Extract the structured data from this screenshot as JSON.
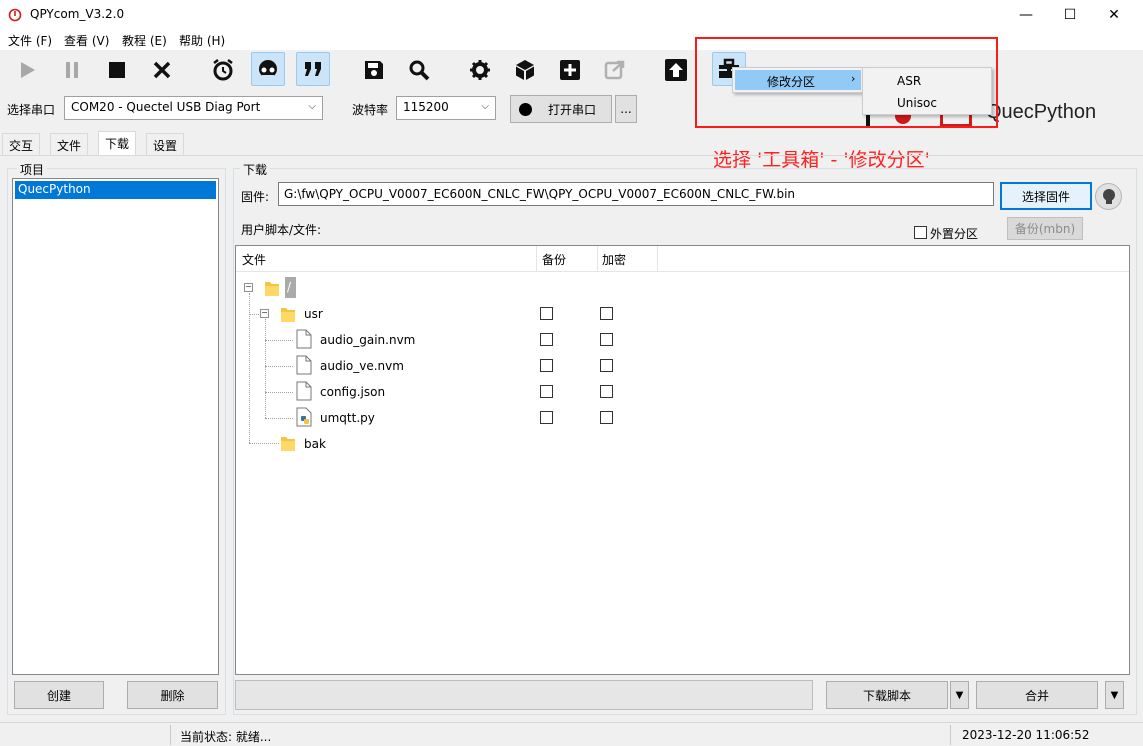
{
  "window": {
    "title": "QPYcom_V3.2.0",
    "min_glyph": "—",
    "max_glyph": "☐",
    "close_glyph": "✕"
  },
  "menubar": [
    "文件 (F)",
    "查看 (V)",
    "教程 (E)",
    "帮助 (H)"
  ],
  "toolbar": {
    "icons": [
      "play-icon",
      "pause-icon",
      "stop-icon",
      "close-x-icon",
      "alarm-clock-icon",
      "recorder-icon",
      "quote-icon",
      "save-icon",
      "search-icon",
      "gear-icon",
      "cube-icon",
      "plus-icon",
      "share-icon",
      "upload-icon",
      "toolbox-icon"
    ]
  },
  "port": {
    "label": "选择串口",
    "value": "COM20 - Quectel USB Diag Port",
    "baud_label": "波特率",
    "baud_value": "115200",
    "open_label": "打开串口",
    "more_label": "..."
  },
  "tabs": [
    "交互",
    "文件",
    "下载",
    "设置"
  ],
  "selected_tab": "下载",
  "project": {
    "group_title": "项目",
    "items": [
      "QuecPython"
    ],
    "create_label": "创建",
    "delete_label": "删除"
  },
  "download": {
    "group_title": "下载",
    "firmware_label": "固件:",
    "firmware_path": "G:\\fw\\QPY_OCPU_V0007_EC600N_CNLC_FW\\QPY_OCPU_V0007_EC600N_CNLC_FW.bin",
    "choose_firmware_label": "选择固件",
    "user_script_label": "用户脚本/文件:",
    "external_partition_label": "外置分区",
    "backup_mbn_label": "备份(mbn)",
    "columns": [
      "文件",
      "备份",
      "加密"
    ],
    "tree": {
      "root": "/",
      "usr": "usr",
      "files": [
        "audio_gain.nvm",
        "audio_ve.nvm",
        "config.json",
        "umqtt.py"
      ],
      "bak": "bak"
    },
    "download_script_label": "下载脚本",
    "merge_label": "合并"
  },
  "context_menu": {
    "item": "修改分区",
    "submenu": [
      "ASR",
      "Unisoc"
    ]
  },
  "brand_text": "QuecPython",
  "annotation": "选择 '工具箱' - '修改分区'",
  "status": {
    "text": "当前状态: 就绪...",
    "datetime": "2023-12-20 11:06:52"
  },
  "colors": {
    "accent": "#0078d7",
    "annotation": "#ff1a1a",
    "selection": "#0078d7"
  }
}
